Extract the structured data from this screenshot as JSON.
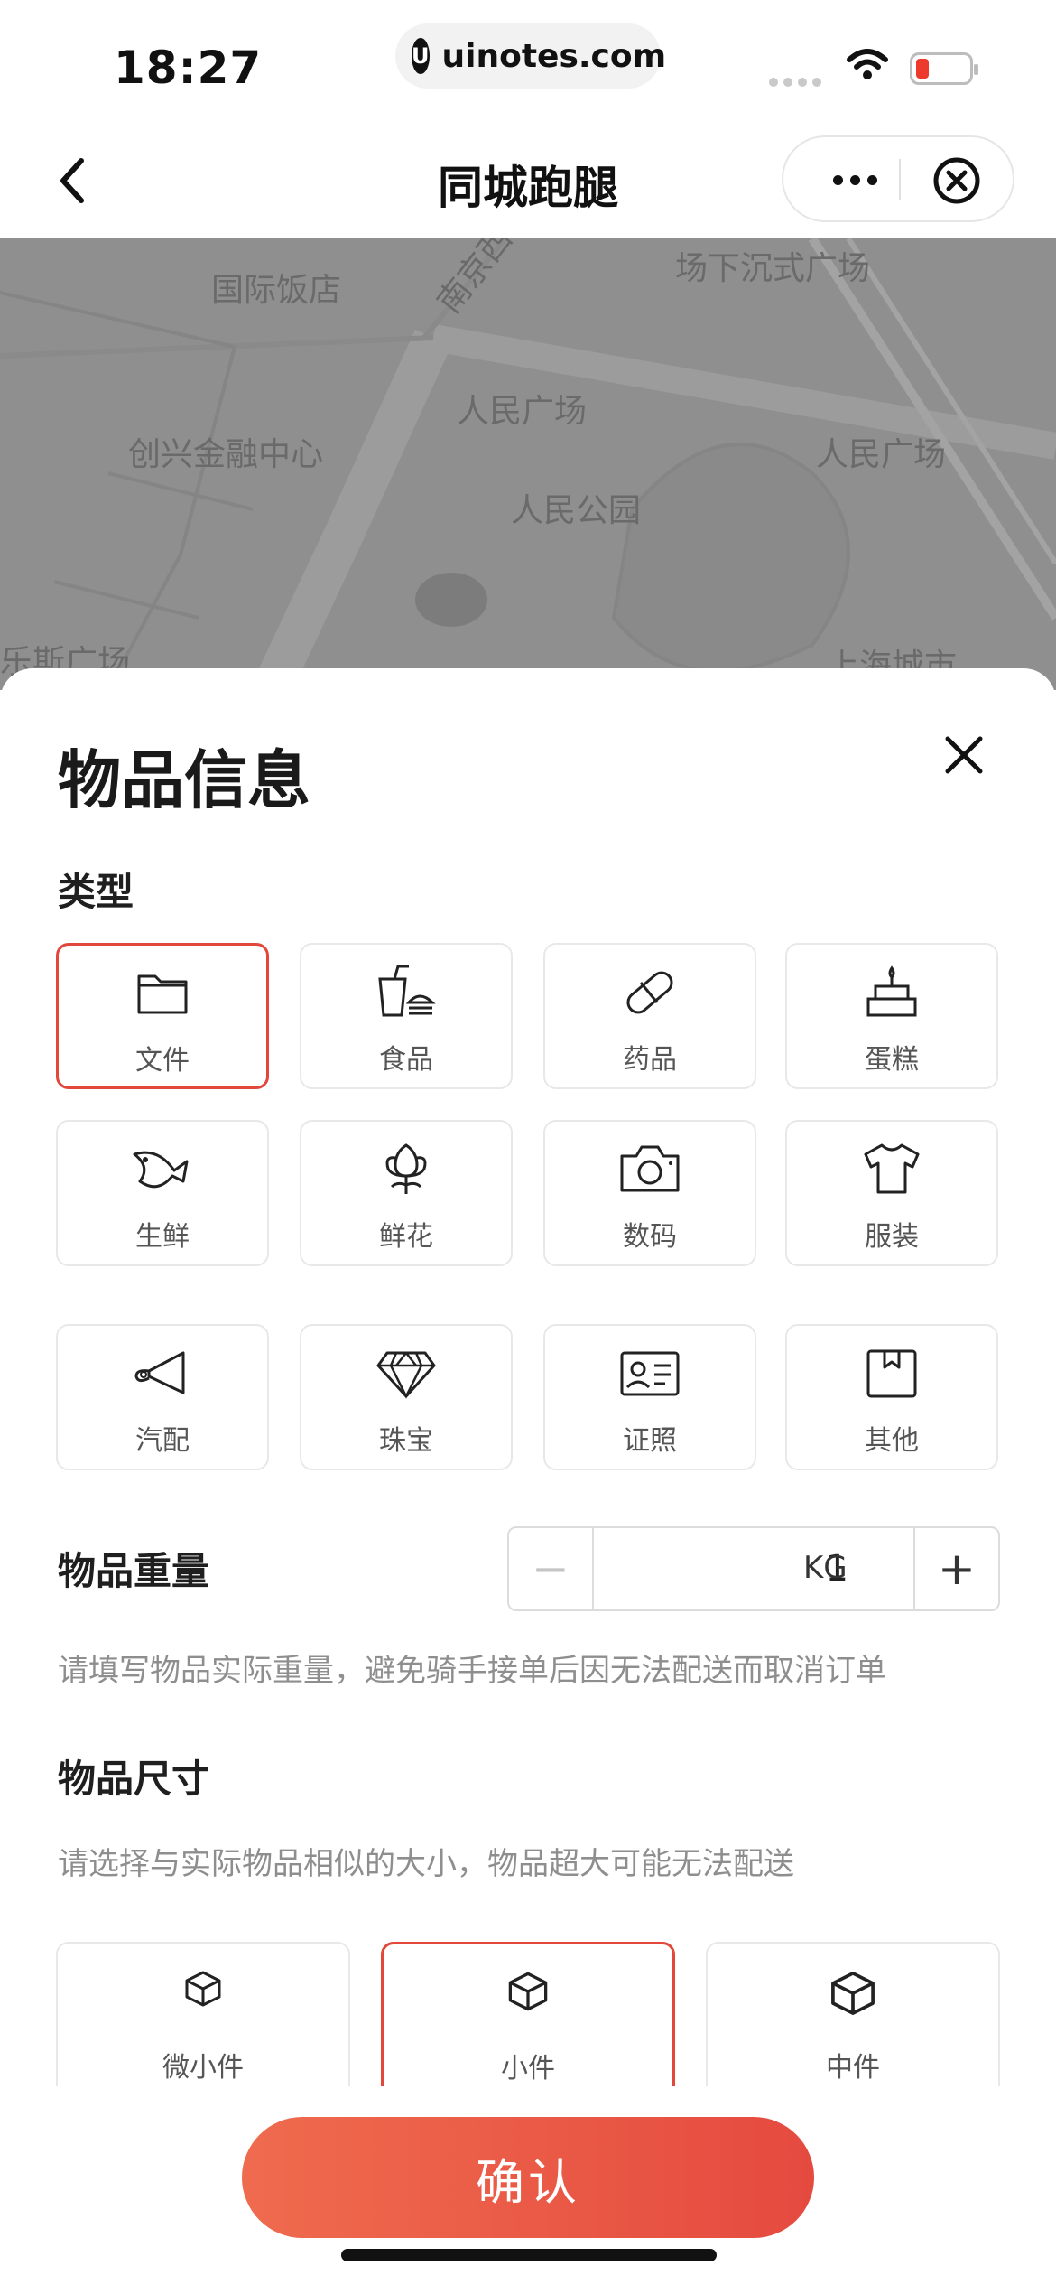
{
  "status_bar": {
    "time": "18:27",
    "url": "uinotes.com",
    "logo_letter": "U",
    "battery_color": "#ee3a2c"
  },
  "nav": {
    "title": "同城跑腿",
    "back_icon": "chevron-left-icon",
    "more_icon": "more-dots-icon",
    "close_icon": "close-circle-icon"
  },
  "map": {
    "labels": [
      "国际饭店",
      "南京西",
      "场下沉式广场",
      "人民广场",
      "创兴金融中心",
      "人民广场",
      "人民公园",
      "乐斯广场",
      "上海城市"
    ]
  },
  "sheet": {
    "title": "物品信息",
    "type_label": "类型",
    "types": [
      {
        "label": "文件",
        "icon": "folder-icon",
        "selected": true
      },
      {
        "label": "食品",
        "icon": "drink-burger-icon",
        "selected": false
      },
      {
        "label": "药品",
        "icon": "pill-icon",
        "selected": false
      },
      {
        "label": "蛋糕",
        "icon": "cake-icon",
        "selected": false
      },
      {
        "label": "生鲜",
        "icon": "fish-icon",
        "selected": false
      },
      {
        "label": "鲜花",
        "icon": "flower-icon",
        "selected": false
      },
      {
        "label": "数码",
        "icon": "camera-icon",
        "selected": false
      },
      {
        "label": "服装",
        "icon": "shirt-icon",
        "selected": false
      },
      {
        "label": "汽配",
        "icon": "horn-icon",
        "selected": false
      },
      {
        "label": "珠宝",
        "icon": "diamond-icon",
        "selected": false
      },
      {
        "label": "证照",
        "icon": "id-card-icon",
        "selected": false
      },
      {
        "label": "其他",
        "icon": "box-icon",
        "selected": false
      }
    ],
    "weight": {
      "label": "物品重量",
      "value": "1",
      "unit": "KG",
      "minus": "−",
      "plus": "+",
      "hint": "请填写物品实际重量，避免骑手接单后因无法配送而取消订单"
    },
    "size": {
      "label": "物品尺寸",
      "hint": "请选择与实际物品相似的大小，物品超大可能无法配送",
      "options": [
        {
          "label": "微小件",
          "selected": false
        },
        {
          "label": "小件",
          "selected": true
        },
        {
          "label": "中件",
          "selected": false
        }
      ]
    },
    "confirm_label": "确认",
    "accent_color": "#e2473b"
  }
}
